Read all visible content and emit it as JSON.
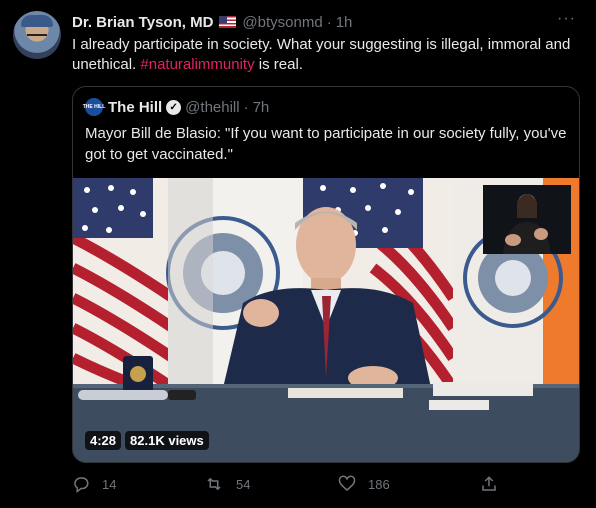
{
  "tweet": {
    "author_name": "Dr. Brian Tyson, MD",
    "handle": "@btysonmd",
    "separator": "·",
    "time": "1h",
    "text_before": "I already participate in society.  What your suggesting is illegal, immoral and unethical. ",
    "hashtag": "#naturalimmunity",
    "text_after": " is real.",
    "more_label": "···"
  },
  "quoted": {
    "avatar_text": "THE HILL",
    "author_name": "The Hill",
    "handle": "@thehill",
    "separator": "·",
    "time": "7h",
    "text": "Mayor Bill de Blasio: \"If you want to participate in our society fully, you've got to get vaccinated.\"",
    "video": {
      "duration": "4:28",
      "views": "82.1K views"
    }
  },
  "actions": {
    "replies": "14",
    "retweets": "54",
    "likes": "186"
  },
  "colors": {
    "background": "#000000",
    "text": "#e7e9ea",
    "secondary": "#71767b",
    "hashtag": "#e0245e",
    "border": "#333639"
  },
  "icons": [
    "reply-icon",
    "retweet-icon",
    "like-icon",
    "share-icon",
    "verified-icon",
    "flag-icon",
    "more-icon"
  ]
}
